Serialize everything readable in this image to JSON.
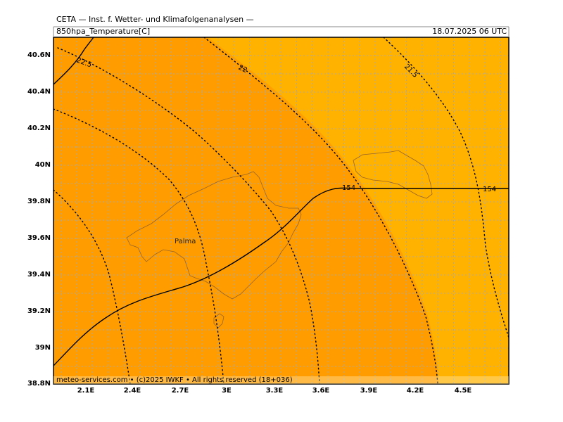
{
  "header": {
    "org": "CETA — Inst. f. Wetter- und Klimafolgenanalysen —",
    "variable": "850hpa_Temperature[C]",
    "valid_time": "18.07.2025 06 UTC"
  },
  "axes": {
    "y_labels": [
      "40.6N",
      "40.4N",
      "40.2N",
      "40N",
      "39.8N",
      "39.6N",
      "39.4N",
      "39.2N",
      "39N",
      "38.8N"
    ],
    "x_labels": [
      "2.1E",
      "2.4E",
      "2.7E",
      "3E",
      "3.3E",
      "3.6E",
      "3.9E",
      "4.2E",
      "4.5E"
    ]
  },
  "contours": {
    "temp_labels": [
      "22.5",
      "22",
      "21.5"
    ],
    "height_labels": [
      "154",
      "154"
    ]
  },
  "places": {
    "palma": "Palma"
  },
  "footer": "meteo-services.com • (c)2025 IWKF • All rights reserved (18+036)",
  "colors": {
    "warm_fill": "#FFA000",
    "warmer_fill": "#FF9900",
    "cool_fill": "#FFB200",
    "coastline": "#A06A2A",
    "contour": "#000000"
  }
}
